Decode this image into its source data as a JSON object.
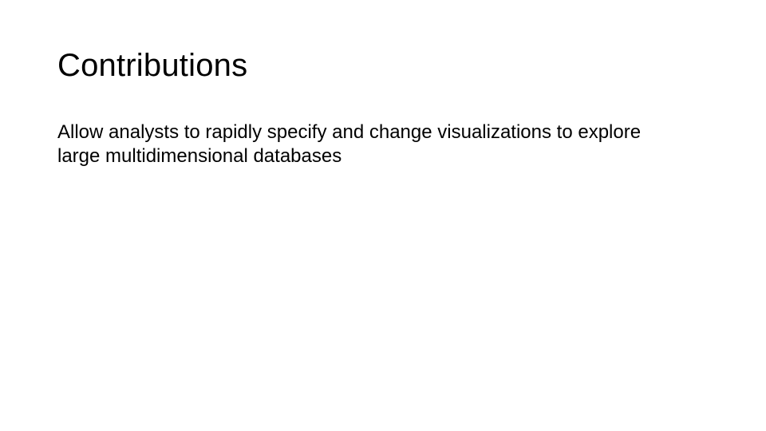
{
  "slide": {
    "title": "Contributions",
    "body": "Allow analysts to rapidly specify and change visualizations to explore large multidimensional databases"
  }
}
